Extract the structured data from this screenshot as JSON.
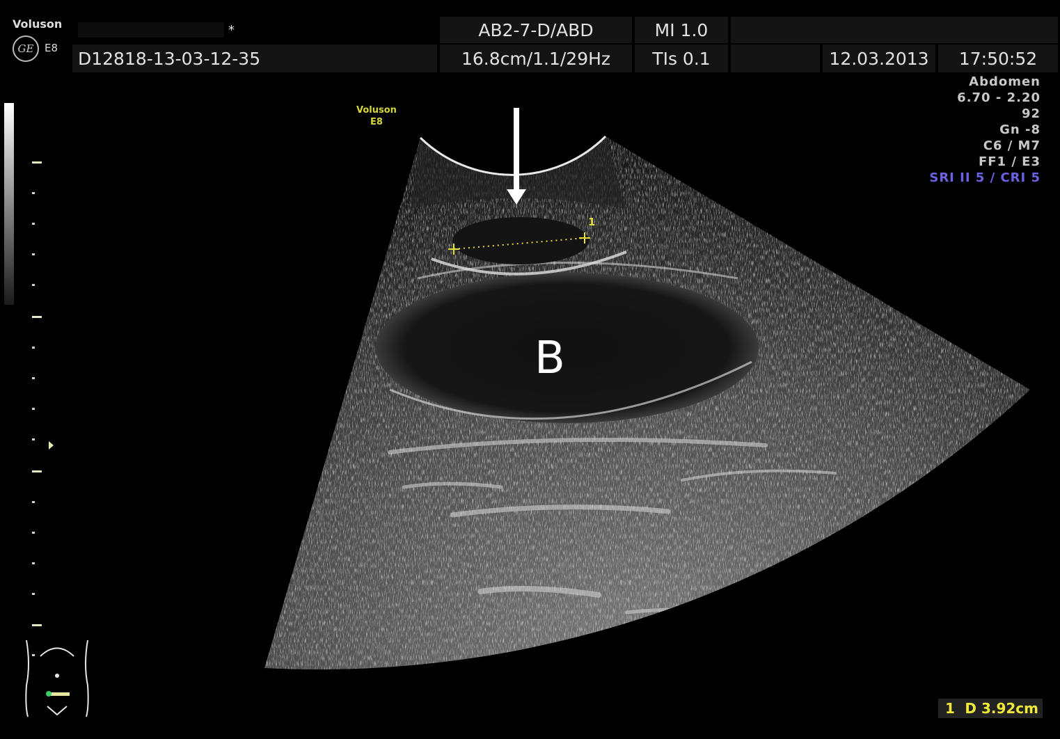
{
  "header": {
    "brand": "Voluson",
    "logo": "GE",
    "model": "E8",
    "patient_marker": "*",
    "study_id": "D12818-13-03-12-35",
    "probe": "AB2-7-D/ABD",
    "depth_info": "16.8cm/1.1/29Hz",
    "mi": "MI  1.0",
    "tis": "TIs  0.1",
    "date": "12.03.2013",
    "time": "17:50:52"
  },
  "params": {
    "preset": "Abdomen",
    "freq": "6.70 - 2.20",
    "power": "92",
    "gain": "Gn  -8",
    "map": "C6 / M7",
    "filter": "FF1 / E3",
    "sri": "SRI II 5 / CRI 5"
  },
  "watermark": {
    "line1": "Voluson",
    "line2": "E8"
  },
  "annotations": {
    "organ_label": "B",
    "caliper_index": "1"
  },
  "measurement": {
    "index": "1",
    "value": "D 3.92cm"
  },
  "colors": {
    "background": "#000000",
    "caliper": "#e6e13a",
    "accent_param": "#6a62e0",
    "arrow": "#ffffff"
  }
}
